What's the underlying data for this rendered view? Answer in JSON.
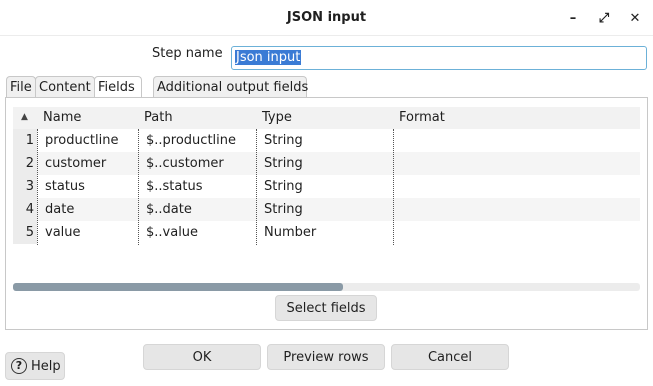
{
  "window": {
    "title": "JSON input",
    "minimize_glyph": "–",
    "maximize_glyph": "⤢",
    "close_glyph": "✕"
  },
  "step": {
    "label": "Step name",
    "value": "Json input"
  },
  "tabs": [
    {
      "label": "File",
      "active": false
    },
    {
      "label": "Content",
      "active": false
    },
    {
      "label": "Fields",
      "active": true
    },
    {
      "label": "Additional output fields",
      "active": false
    }
  ],
  "grid": {
    "sort_glyph": "▲",
    "columns": [
      "Name",
      "Path",
      "Type",
      "Format"
    ],
    "rows": [
      {
        "num": "1",
        "name": "productline",
        "path": "$..productline",
        "type": "String",
        "format": ""
      },
      {
        "num": "2",
        "name": "customer",
        "path": "$..customer",
        "type": "String",
        "format": ""
      },
      {
        "num": "3",
        "name": "status",
        "path": "$..status",
        "type": "String",
        "format": ""
      },
      {
        "num": "4",
        "name": "date",
        "path": "$..date",
        "type": "String",
        "format": ""
      },
      {
        "num": "5",
        "name": "value",
        "path": "$..value",
        "type": "Number",
        "format": ""
      }
    ]
  },
  "buttons": {
    "select_fields": "Select fields",
    "ok": "OK",
    "preview_rows": "Preview rows",
    "cancel": "Cancel",
    "help": "Help",
    "help_glyph": "?"
  }
}
